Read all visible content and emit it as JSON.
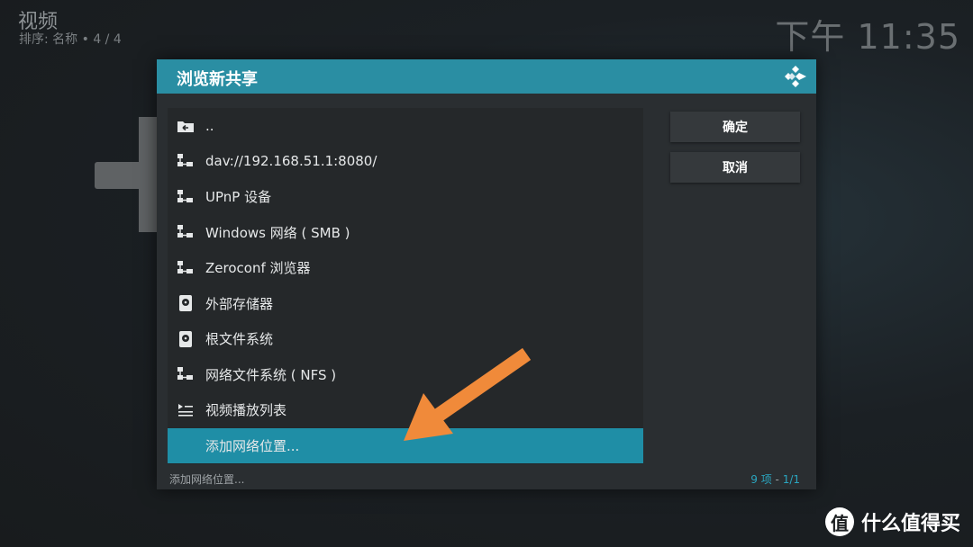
{
  "header": {
    "title": "视频",
    "subtitle": "排序: 名称  •  4 / 4",
    "clock": "下午 11:35"
  },
  "dialog": {
    "title": "浏览新共享",
    "items": [
      {
        "label": "..",
        "icon": "folder-back-icon"
      },
      {
        "label": "dav://192.168.51.1:8080/",
        "icon": "network-icon"
      },
      {
        "label": "UPnP 设备",
        "icon": "network-icon"
      },
      {
        "label": "Windows 网络 ( SMB )",
        "icon": "network-icon"
      },
      {
        "label": "Zeroconf 浏览器",
        "icon": "network-icon"
      },
      {
        "label": "外部存储器",
        "icon": "hdd-icon"
      },
      {
        "label": "根文件系统",
        "icon": "hdd-icon"
      },
      {
        "label": "网络文件系统 ( NFS )",
        "icon": "network-icon"
      },
      {
        "label": "视频播放列表",
        "icon": "playlist-icon"
      },
      {
        "label": "添加网络位置...",
        "icon": ""
      }
    ],
    "selected_index": 9,
    "buttons": {
      "ok": "确定",
      "cancel": "取消"
    },
    "footer": {
      "status": "添加网络位置...",
      "count": "9 项",
      "sep": " - ",
      "page": "1/1"
    }
  },
  "colors": {
    "accent": "#2a8ea3",
    "selected": "#1f8ea6",
    "arrow": "#f08a3a"
  },
  "watermark": {
    "badge": "值",
    "text": "什么值得买"
  }
}
